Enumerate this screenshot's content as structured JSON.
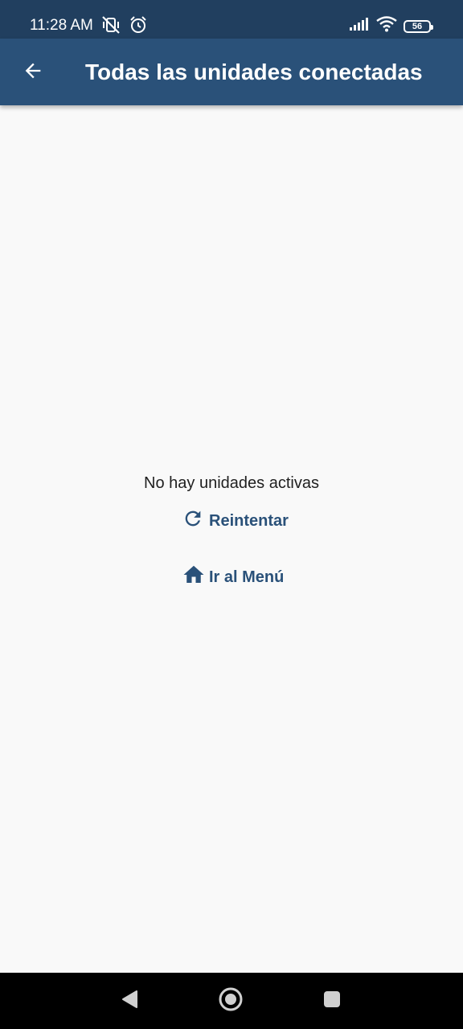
{
  "status_bar": {
    "time": "11:28 AM",
    "battery_level": "56",
    "icons": [
      "mute-vibrate-icon",
      "alarm-icon",
      "signal-icon",
      "wifi-icon",
      "battery-icon"
    ]
  },
  "app_bar": {
    "title": "Todas las unidades conectadas",
    "back_icon": "arrow-back-icon"
  },
  "content": {
    "empty_message": "No hay unidades activas",
    "retry_label": "Reintentar",
    "retry_icon": "refresh-icon",
    "menu_label": "Ir al Menú",
    "menu_icon": "home-icon"
  },
  "nav_bar": {
    "buttons": [
      "back-triangle-icon",
      "home-circle-icon",
      "recents-square-icon"
    ]
  },
  "colors": {
    "status_bar": "#213f5f",
    "app_bar": "#2a5179",
    "accent": "#2a5179",
    "background": "#f9f9f9"
  }
}
